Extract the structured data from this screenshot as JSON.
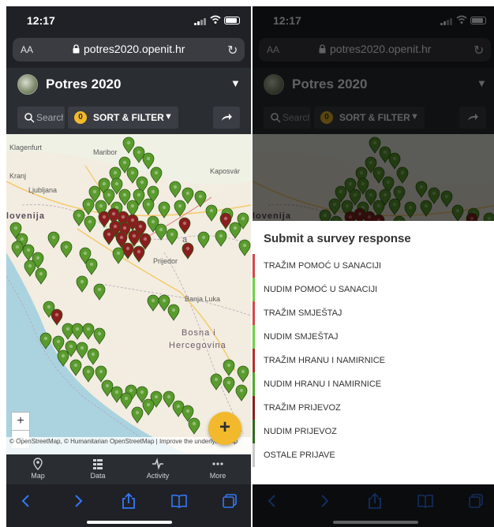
{
  "status": {
    "time": "12:17"
  },
  "browser": {
    "text_size": "AA",
    "url": "potres2020.openit.hr"
  },
  "app": {
    "title": "Potres 2020"
  },
  "toolbar": {
    "search_placeholder": "Search",
    "filter_count": "0",
    "filter_label": "SORT & FILTER"
  },
  "map": {
    "labels": {
      "klagenfurt": "Klagenfurt",
      "maribor": "Maribor",
      "kranj": "Kranj",
      "ljubljana": "Ljubljana",
      "slovenija": "lovenija",
      "kaposvar": "Kaposvár",
      "prijedor": "Prijedor",
      "banja_luka": "Banja Luka",
      "bosna": "Bosna i",
      "hercegovina": "Hercegovina",
      "a": "a"
    },
    "zoom_in": "+",
    "zoom_out": "−",
    "attribution": "© OpenStreetMap, © Humanitarian OpenStreetMap | Improve the underlying map",
    "marker_colors": {
      "green": "#5a9b2d",
      "red": "#8a1d1d",
      "outline": "#2d5a15"
    }
  },
  "fab": {
    "label": "+"
  },
  "nav": [
    {
      "label": "Map",
      "icon": "map-pin-icon"
    },
    {
      "label": "Data",
      "icon": "list-icon"
    },
    {
      "label": "Activity",
      "icon": "pulse-icon"
    },
    {
      "label": "More",
      "icon": "more-icon"
    }
  ],
  "sheet": {
    "title": "Submit a survey response",
    "options": [
      {
        "label": "TRAŽIM POMOĆ U SANACIJI",
        "color": "#d64848"
      },
      {
        "label": "NUDIM POMOĆ U SANACIJI",
        "color": "#6fcf4a"
      },
      {
        "label": "TRAŽIM SMJEŠTAJ",
        "color": "#d64848"
      },
      {
        "label": "NUDIM SMJEŠTAJ",
        "color": "#6fcf4a"
      },
      {
        "label": "TRAŽIM HRANU I NAMIRNICE",
        "color": "#b52d2d"
      },
      {
        "label": "NUDIM HRANU I NAMIRNICE",
        "color": "#4ea82d"
      },
      {
        "label": "TRAŽIM PRIJEVOZ",
        "color": "#8a1d1d"
      },
      {
        "label": "NUDIM PRIJEVOZ",
        "color": "#2f6b1a"
      },
      {
        "label": "OSTALE PRIJAVE",
        "color": "#c8c8c8"
      }
    ]
  }
}
